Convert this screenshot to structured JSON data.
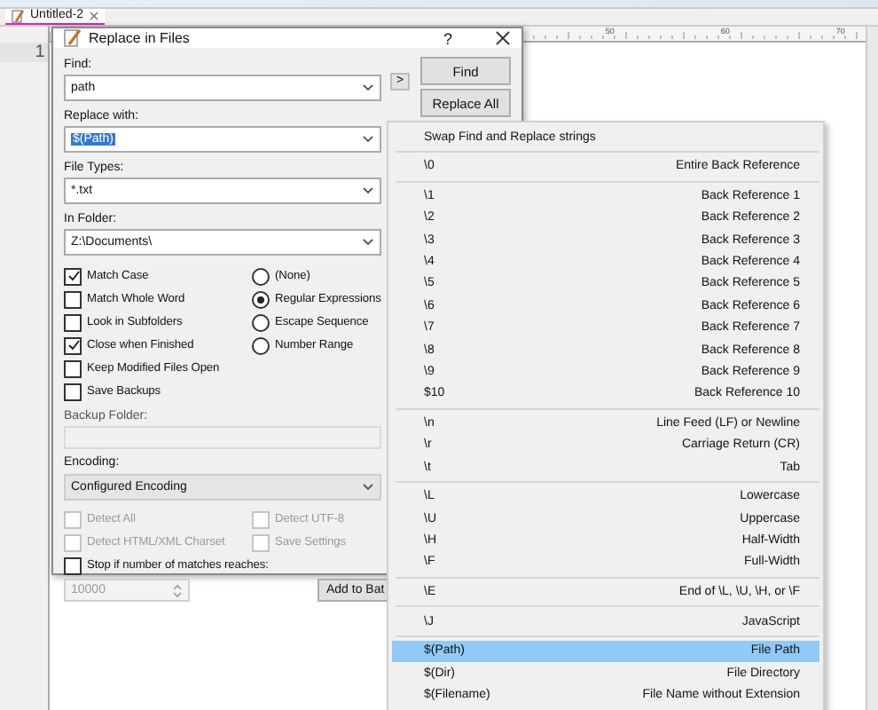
{
  "tabs": [
    {
      "label": "Untitled-2",
      "selected": true
    }
  ],
  "ruler": {
    "labels": [
      "50",
      "60",
      "70"
    ]
  },
  "editor": {
    "line_numbers": [
      "1"
    ]
  },
  "dialog": {
    "title": "Replace in Files",
    "help": "?",
    "fields": [
      {
        "label": "Find:",
        "value": "path",
        "value_selected": false
      },
      {
        "label": "Replace with:",
        "value": "$(Path)",
        "value_selected": true
      },
      {
        "label": "File Types:",
        "value": "*.txt",
        "value_selected": false
      },
      {
        "label": "In Folder:",
        "value": "Z:\\Documents\\",
        "value_selected": false
      }
    ],
    "expand_button": ">",
    "buttons": [
      {
        "label": "Find"
      },
      {
        "label": "Replace All"
      }
    ],
    "options": [
      {
        "label": "Match Case",
        "checked": true
      },
      {
        "label": "Match Whole Word",
        "checked": false
      },
      {
        "label": "Look in Subfolders",
        "checked": false
      },
      {
        "label": "Close when Finished",
        "checked": true
      },
      {
        "label": "Keep Modified Files Open",
        "checked": false
      },
      {
        "label": "Save Backups",
        "checked": false
      }
    ],
    "modes": [
      {
        "label": "(None)",
        "selected": false
      },
      {
        "label": "Regular Expressions",
        "selected": true
      },
      {
        "label": "Escape Sequence",
        "selected": false
      },
      {
        "label": "Number Range",
        "selected": false
      }
    ],
    "backup_folder": {
      "label": "Backup Folder:",
      "disabled": true
    },
    "encoding": {
      "label": "Encoding:",
      "value": "Configured Encoding"
    },
    "detect": [
      {
        "label": "Detect All",
        "checked": false,
        "disabled": true
      },
      {
        "label": "Detect UTF-8",
        "checked": false,
        "disabled": true
      },
      {
        "label": "Detect HTML/XML Charset",
        "checked": false,
        "disabled": true
      },
      {
        "label": "Save Settings",
        "checked": false,
        "disabled": true
      }
    ],
    "stop": {
      "label": "Stop if number of matches reaches:",
      "checked": false
    },
    "limit": {
      "value": "10000",
      "disabled": true
    },
    "batch_button": "Add to Bat"
  },
  "menu": {
    "items": [
      {
        "kind": "item",
        "text": "Swap Find and Replace strings",
        "selected": false
      },
      {
        "kind": "separator"
      },
      {
        "kind": "item",
        "text": "\\0",
        "description": "Entire Back Reference",
        "selected": false
      },
      {
        "kind": "separator"
      },
      {
        "kind": "item",
        "text": "\\1",
        "description": "Back Reference 1",
        "selected": false
      },
      {
        "kind": "item",
        "text": "\\2",
        "description": "Back Reference 2",
        "selected": false
      },
      {
        "kind": "item",
        "text": "\\3",
        "description": "Back Reference 3",
        "selected": false
      },
      {
        "kind": "item",
        "text": "\\4",
        "description": "Back Reference 4",
        "selected": false
      },
      {
        "kind": "item",
        "text": "\\5",
        "description": "Back Reference 5",
        "selected": false
      },
      {
        "kind": "item",
        "text": "\\6",
        "description": "Back Reference 6",
        "selected": false
      },
      {
        "kind": "item",
        "text": "\\7",
        "description": "Back Reference 7",
        "selected": false
      },
      {
        "kind": "item",
        "text": "\\8",
        "description": "Back Reference 8",
        "selected": false
      },
      {
        "kind": "item",
        "text": "\\9",
        "description": "Back Reference 9",
        "selected": false
      },
      {
        "kind": "item",
        "text": "$10",
        "description": "Back Reference 10",
        "selected": false
      },
      {
        "kind": "separator"
      },
      {
        "kind": "item",
        "text": "\\n",
        "description": "Line Feed (LF) or Newline",
        "selected": false
      },
      {
        "kind": "item",
        "text": "\\r",
        "description": "Carriage Return (CR)",
        "selected": false
      },
      {
        "kind": "item",
        "text": "\\t",
        "description": "Tab",
        "selected": false
      },
      {
        "kind": "separator"
      },
      {
        "kind": "item",
        "text": "\\L",
        "description": "Lowercase",
        "selected": false
      },
      {
        "kind": "item",
        "text": "\\U",
        "description": "Uppercase",
        "selected": false
      },
      {
        "kind": "item",
        "text": "\\H",
        "description": "Half-Width",
        "selected": false
      },
      {
        "kind": "item",
        "text": "\\F",
        "description": "Full-Width",
        "selected": false
      },
      {
        "kind": "separator"
      },
      {
        "kind": "item",
        "text": "\\E",
        "description": "End of \\L, \\U, \\H,  or \\F",
        "selected": false
      },
      {
        "kind": "separator"
      },
      {
        "kind": "item",
        "text": "\\J",
        "description": "JavaScript",
        "selected": false
      },
      {
        "kind": "separator"
      },
      {
        "kind": "item",
        "text": "$(Path)",
        "description": "File Path",
        "selected": true
      },
      {
        "kind": "item",
        "text": "$(Dir)",
        "description": "File Directory",
        "selected": false
      },
      {
        "kind": "item",
        "text": "$(Filename)",
        "description": "File Name without Extension",
        "selected": false
      }
    ]
  }
}
